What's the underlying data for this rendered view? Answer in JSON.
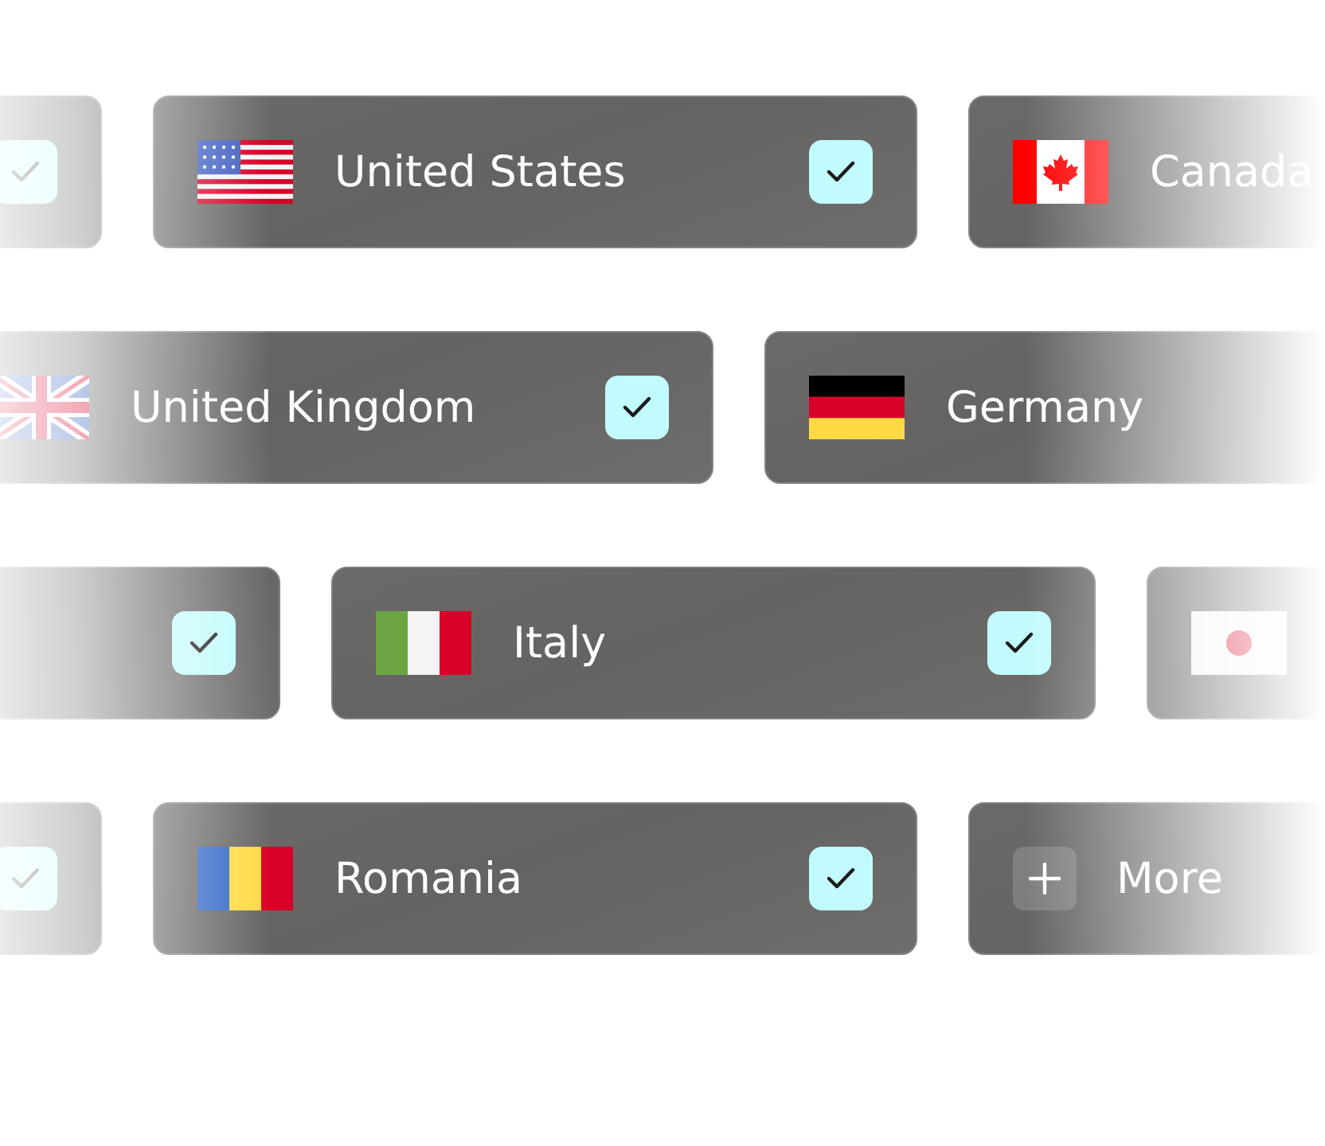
{
  "rows": [
    {
      "cards": [
        {
          "kind": "plain",
          "checked": true
        },
        {
          "kind": "us",
          "name": "United States",
          "checked": true
        },
        {
          "kind": "ca",
          "name": "Canada"
        }
      ]
    },
    {
      "cards": [
        {
          "kind": "gb",
          "name": "United Kingdom",
          "checked": true
        },
        {
          "kind": "de",
          "name": "Germany"
        }
      ]
    },
    {
      "cards": [
        {
          "kind": "plain",
          "checked": true
        },
        {
          "kind": "it",
          "name": "Italy",
          "checked": true
        },
        {
          "kind": "jp"
        }
      ]
    },
    {
      "cards": [
        {
          "kind": "plain",
          "checked": true
        },
        {
          "kind": "ro",
          "name": "Romania",
          "checked": true
        },
        {
          "kind": "more",
          "name": "More"
        }
      ]
    }
  ]
}
